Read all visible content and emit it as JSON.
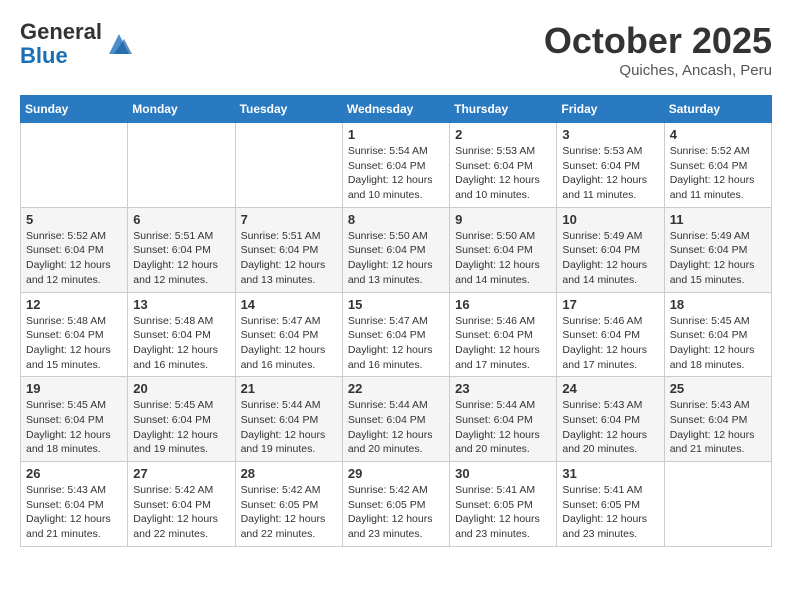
{
  "header": {
    "logo_general": "General",
    "logo_blue": "Blue",
    "month_title": "October 2025",
    "location": "Quiches, Ancash, Peru"
  },
  "days_of_week": [
    "Sunday",
    "Monday",
    "Tuesday",
    "Wednesday",
    "Thursday",
    "Friday",
    "Saturday"
  ],
  "weeks": [
    [
      {
        "day": "",
        "info": ""
      },
      {
        "day": "",
        "info": ""
      },
      {
        "day": "",
        "info": ""
      },
      {
        "day": "1",
        "info": "Sunrise: 5:54 AM\nSunset: 6:04 PM\nDaylight: 12 hours\nand 10 minutes."
      },
      {
        "day": "2",
        "info": "Sunrise: 5:53 AM\nSunset: 6:04 PM\nDaylight: 12 hours\nand 10 minutes."
      },
      {
        "day": "3",
        "info": "Sunrise: 5:53 AM\nSunset: 6:04 PM\nDaylight: 12 hours\nand 11 minutes."
      },
      {
        "day": "4",
        "info": "Sunrise: 5:52 AM\nSunset: 6:04 PM\nDaylight: 12 hours\nand 11 minutes."
      }
    ],
    [
      {
        "day": "5",
        "info": "Sunrise: 5:52 AM\nSunset: 6:04 PM\nDaylight: 12 hours\nand 12 minutes."
      },
      {
        "day": "6",
        "info": "Sunrise: 5:51 AM\nSunset: 6:04 PM\nDaylight: 12 hours\nand 12 minutes."
      },
      {
        "day": "7",
        "info": "Sunrise: 5:51 AM\nSunset: 6:04 PM\nDaylight: 12 hours\nand 13 minutes."
      },
      {
        "day": "8",
        "info": "Sunrise: 5:50 AM\nSunset: 6:04 PM\nDaylight: 12 hours\nand 13 minutes."
      },
      {
        "day": "9",
        "info": "Sunrise: 5:50 AM\nSunset: 6:04 PM\nDaylight: 12 hours\nand 14 minutes."
      },
      {
        "day": "10",
        "info": "Sunrise: 5:49 AM\nSunset: 6:04 PM\nDaylight: 12 hours\nand 14 minutes."
      },
      {
        "day": "11",
        "info": "Sunrise: 5:49 AM\nSunset: 6:04 PM\nDaylight: 12 hours\nand 15 minutes."
      }
    ],
    [
      {
        "day": "12",
        "info": "Sunrise: 5:48 AM\nSunset: 6:04 PM\nDaylight: 12 hours\nand 15 minutes."
      },
      {
        "day": "13",
        "info": "Sunrise: 5:48 AM\nSunset: 6:04 PM\nDaylight: 12 hours\nand 16 minutes."
      },
      {
        "day": "14",
        "info": "Sunrise: 5:47 AM\nSunset: 6:04 PM\nDaylight: 12 hours\nand 16 minutes."
      },
      {
        "day": "15",
        "info": "Sunrise: 5:47 AM\nSunset: 6:04 PM\nDaylight: 12 hours\nand 16 minutes."
      },
      {
        "day": "16",
        "info": "Sunrise: 5:46 AM\nSunset: 6:04 PM\nDaylight: 12 hours\nand 17 minutes."
      },
      {
        "day": "17",
        "info": "Sunrise: 5:46 AM\nSunset: 6:04 PM\nDaylight: 12 hours\nand 17 minutes."
      },
      {
        "day": "18",
        "info": "Sunrise: 5:45 AM\nSunset: 6:04 PM\nDaylight: 12 hours\nand 18 minutes."
      }
    ],
    [
      {
        "day": "19",
        "info": "Sunrise: 5:45 AM\nSunset: 6:04 PM\nDaylight: 12 hours\nand 18 minutes."
      },
      {
        "day": "20",
        "info": "Sunrise: 5:45 AM\nSunset: 6:04 PM\nDaylight: 12 hours\nand 19 minutes."
      },
      {
        "day": "21",
        "info": "Sunrise: 5:44 AM\nSunset: 6:04 PM\nDaylight: 12 hours\nand 19 minutes."
      },
      {
        "day": "22",
        "info": "Sunrise: 5:44 AM\nSunset: 6:04 PM\nDaylight: 12 hours\nand 20 minutes."
      },
      {
        "day": "23",
        "info": "Sunrise: 5:44 AM\nSunset: 6:04 PM\nDaylight: 12 hours\nand 20 minutes."
      },
      {
        "day": "24",
        "info": "Sunrise: 5:43 AM\nSunset: 6:04 PM\nDaylight: 12 hours\nand 20 minutes."
      },
      {
        "day": "25",
        "info": "Sunrise: 5:43 AM\nSunset: 6:04 PM\nDaylight: 12 hours\nand 21 minutes."
      }
    ],
    [
      {
        "day": "26",
        "info": "Sunrise: 5:43 AM\nSunset: 6:04 PM\nDaylight: 12 hours\nand 21 minutes."
      },
      {
        "day": "27",
        "info": "Sunrise: 5:42 AM\nSunset: 6:04 PM\nDaylight: 12 hours\nand 22 minutes."
      },
      {
        "day": "28",
        "info": "Sunrise: 5:42 AM\nSunset: 6:05 PM\nDaylight: 12 hours\nand 22 minutes."
      },
      {
        "day": "29",
        "info": "Sunrise: 5:42 AM\nSunset: 6:05 PM\nDaylight: 12 hours\nand 23 minutes."
      },
      {
        "day": "30",
        "info": "Sunrise: 5:41 AM\nSunset: 6:05 PM\nDaylight: 12 hours\nand 23 minutes."
      },
      {
        "day": "31",
        "info": "Sunrise: 5:41 AM\nSunset: 6:05 PM\nDaylight: 12 hours\nand 23 minutes."
      },
      {
        "day": "",
        "info": ""
      }
    ]
  ]
}
